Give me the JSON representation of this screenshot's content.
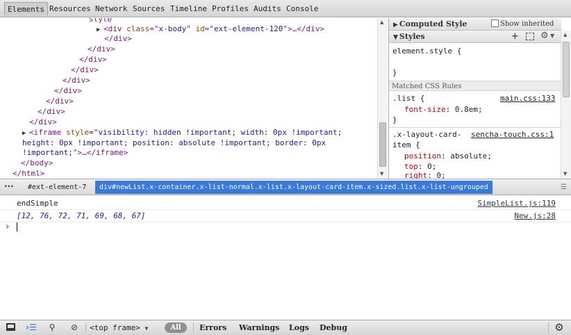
{
  "tabs": [
    "Elements",
    "Resources",
    "Network",
    "Sources",
    "Timeline",
    "Profiles",
    "Audits",
    "Console"
  ],
  "tree": {
    "top_partial": "style\"",
    "xbody_line": {
      "open": "<div",
      "attr": "class",
      "eq1": "=\"",
      "attr_val": "x-body",
      "q1": "\" ",
      "id_attr": "id",
      "eq2": "=\"",
      "id_val": "ext-element-120",
      "close": "\">…</div>"
    },
    "closers": [
      "</div>",
      "</div>",
      "</div>",
      "</div>",
      "</div>",
      "</div>",
      "</div>",
      "</div>",
      "</div>",
      "</div>"
    ],
    "iframe_line1": {
      "open": "<iframe",
      "attr": "style",
      "val": "=\"visibility: hidden !important; width: 0px !important;"
    },
    "iframe_line2": "height: 0px !important; position: absolute !important; border: 0px",
    "iframe_line3": "!important;\">…</iframe>",
    "body_close": "</body>",
    "html_close": "</html>"
  },
  "styles": {
    "computed_title": "Computed Style",
    "show_inherited_label": "Show inherited",
    "styles_title": "Styles",
    "element_style_selector": "element.style {",
    "element_style_close": "}",
    "matched_rules_title": "Matched CSS Rules",
    "rule1": {
      "selector": ".list {",
      "source": "main.css:133",
      "prop": "font-size",
      "value": "0.8em;",
      "close": "}"
    },
    "rule2": {
      "selector": ".x-layout-card-",
      "selector_cont": "item {",
      "source": "sencha-touch.css:1",
      "props": [
        {
          "prop": "position",
          "value": "absolute;"
        },
        {
          "prop": "top",
          "value": "0;"
        },
        {
          "prop": "right",
          "value": "0;"
        }
      ]
    }
  },
  "breadcrumbs": [
    {
      "label": "#ext-element-7",
      "selected": false
    },
    {
      "label": "div#newList.x-container.x-list-normal.x-list.x-layout-card-item.x-sized.list.x-list-ungrouped",
      "selected": true
    }
  ],
  "console": {
    "messages": [
      {
        "text": "endSimple",
        "source": "SimpleList.js:119"
      },
      {
        "text": "[12, 76, 72, 71, 69, 68, 67]",
        "source": "New.js:28"
      }
    ],
    "prompt_symbol": "›"
  },
  "statusbar": {
    "frame_label": "<top frame>",
    "all_label": "All",
    "filters": [
      "Errors",
      "Warnings",
      "Logs",
      "Debug"
    ]
  },
  "colors": {
    "selected_crumb": "#3879d9",
    "tag": "#881280",
    "attr": "#994500",
    "value": "#1a1aa6",
    "css_prop": "#c80000"
  }
}
